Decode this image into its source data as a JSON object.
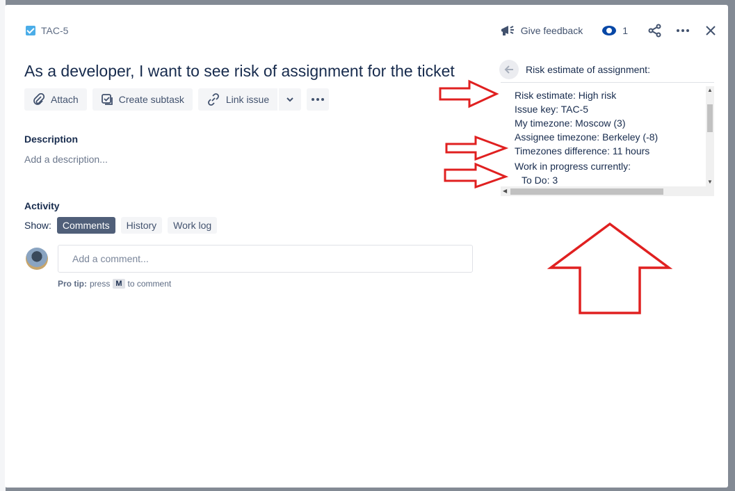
{
  "issue": {
    "key": "TAC-5",
    "title": "As a developer, I want to see risk of assignment for the ticket"
  },
  "header": {
    "feedback_label": "Give feedback",
    "watch_count": "1"
  },
  "toolbar": {
    "attach_label": "Attach",
    "subtask_label": "Create subtask",
    "link_label": "Link issue"
  },
  "description": {
    "label": "Description",
    "placeholder": "Add a description..."
  },
  "activity": {
    "label": "Activity",
    "show_label": "Show:",
    "tabs": [
      "Comments",
      "History",
      "Work log"
    ],
    "active_tab": "Comments",
    "comment_placeholder": "Add a comment...",
    "pro_tip_label": "Pro tip:",
    "pro_tip_press": "press",
    "pro_tip_key": "M",
    "pro_tip_suffix": "to comment"
  },
  "risk_panel": {
    "title": "Risk estimate of assignment:",
    "lines": [
      "Risk estimate: High risk",
      "Issue key: TAC-5",
      "My timezone: Moscow (3)",
      "Assignee timezone: Berkeley (-8)",
      "Timezones difference: 11 hours",
      "Work in progress currently:",
      "To Do: 3"
    ]
  },
  "colors": {
    "accent": "#0052cc",
    "active_chip": "#505f79",
    "annotation": "#e02020"
  },
  "icons": [
    "checkbox-icon",
    "megaphone-icon",
    "eye-icon",
    "share-icon",
    "more-icon",
    "close-icon",
    "paperclip-icon",
    "subtask-icon",
    "link-icon",
    "chevron-down-icon",
    "back-arrow-icon"
  ]
}
